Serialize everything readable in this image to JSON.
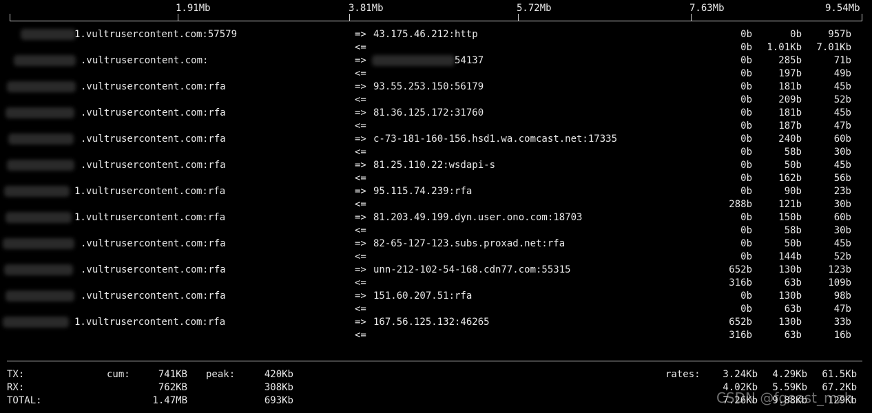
{
  "scale": [
    "1.91Mb",
    "3.81Mb",
    "5.72Mb",
    "7.63Mb",
    "9.54Mb"
  ],
  "connections": [
    {
      "local": "1.vultrusercontent.com:57579",
      "remote": "43.175.46.212:http",
      "tx": [
        "0b",
        "0b",
        "957b"
      ],
      "rx": [
        "0b",
        "1.01Kb",
        "7.01Kb"
      ]
    },
    {
      "local": ".vultrusercontent.com:",
      "remote": "54137",
      "tx": [
        "0b",
        "285b",
        "71b"
      ],
      "rx": [
        "0b",
        "197b",
        "49b"
      ]
    },
    {
      "local": ".vultrusercontent.com:rfa",
      "remote": "93.55.253.150:56179",
      "tx": [
        "0b",
        "181b",
        "45b"
      ],
      "rx": [
        "0b",
        "209b",
        "52b"
      ]
    },
    {
      "local": ".vultrusercontent.com:rfa",
      "remote": "81.36.125.172:31760",
      "tx": [
        "0b",
        "181b",
        "45b"
      ],
      "rx": [
        "0b",
        "187b",
        "47b"
      ]
    },
    {
      "local": ".vultrusercontent.com:rfa",
      "remote": "c-73-181-160-156.hsd1.wa.comcast.net:17335",
      "tx": [
        "0b",
        "240b",
        "60b"
      ],
      "rx": [
        "0b",
        "58b",
        "30b"
      ]
    },
    {
      "local": ".vultrusercontent.com:rfa",
      "remote": "81.25.110.22:wsdapi-s",
      "tx": [
        "0b",
        "50b",
        "45b"
      ],
      "rx": [
        "0b",
        "162b",
        "56b"
      ]
    },
    {
      "local": "1.vultrusercontent.com:rfa",
      "remote": "95.115.74.239:rfa",
      "tx": [
        "0b",
        "90b",
        "23b"
      ],
      "rx": [
        "288b",
        "121b",
        "30b"
      ]
    },
    {
      "local": "1.vultrusercontent.com:rfa",
      "remote": "81.203.49.199.dyn.user.ono.com:18703",
      "tx": [
        "0b",
        "150b",
        "60b"
      ],
      "rx": [
        "0b",
        "58b",
        "30b"
      ]
    },
    {
      "local": ".vultrusercontent.com:rfa",
      "remote": "82-65-127-123.subs.proxad.net:rfa",
      "tx": [
        "0b",
        "50b",
        "45b"
      ],
      "rx": [
        "0b",
        "144b",
        "52b"
      ]
    },
    {
      "local": ".vultrusercontent.com:rfa",
      "remote": "unn-212-102-54-168.cdn77.com:55315",
      "tx": [
        "652b",
        "130b",
        "123b"
      ],
      "rx": [
        "316b",
        "63b",
        "109b"
      ]
    },
    {
      "local": ".vultrusercontent.com:rfa",
      "remote": "151.60.207.51:rfa",
      "tx": [
        "0b",
        "130b",
        "98b"
      ],
      "rx": [
        "0b",
        "63b",
        "47b"
      ]
    },
    {
      "local": "1.vultrusercontent.com:rfa",
      "remote": "167.56.125.132:46265",
      "tx": [
        "652b",
        "130b",
        "33b"
      ],
      "rx": [
        "316b",
        "63b",
        "16b"
      ]
    }
  ],
  "arrows": {
    "out": "=>",
    "in": "<="
  },
  "totals": {
    "labels": {
      "tx": "TX:",
      "rx": "RX:",
      "total": "TOTAL:",
      "cum": "cum:",
      "peak": "peak:",
      "rates": "rates:"
    },
    "tx": {
      "cum": "741KB",
      "peak": "420Kb",
      "rates": [
        "3.24Kb",
        "4.29Kb",
        "61.5Kb"
      ]
    },
    "rx": {
      "cum": "762KB",
      "peak": "308Kb",
      "rates": [
        "4.02Kb",
        "5.59Kb",
        "67.2Kb"
      ]
    },
    "total": {
      "cum": "1.47MB",
      "peak": "693Kb",
      "rates": [
        "7.26Kb",
        "9.88Kb",
        "129Kb"
      ]
    }
  },
  "watermark": "CSDN @fgeast_mzh"
}
